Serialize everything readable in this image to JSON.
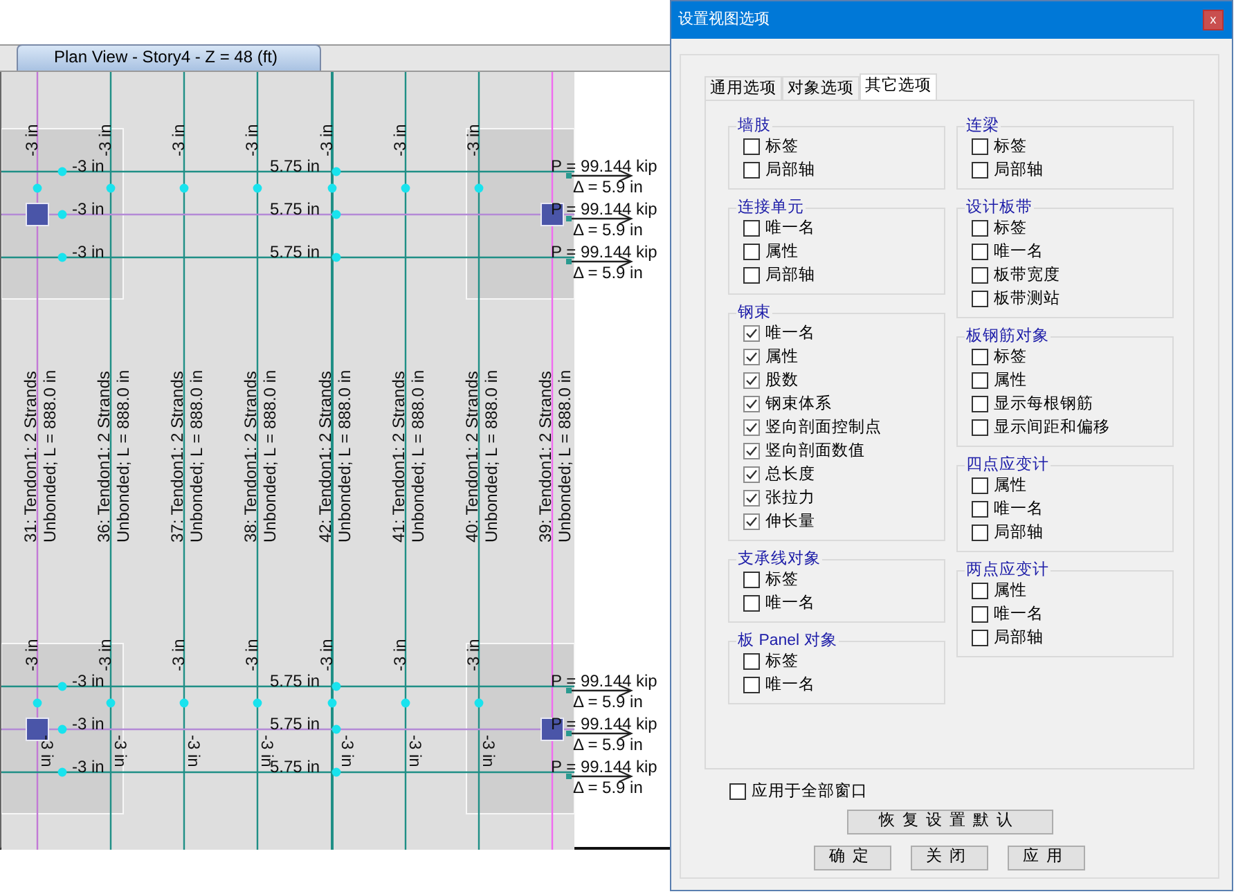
{
  "plan_view": {
    "tab": {
      "label": "Plan View - Story4 - Z = 48 (ft)",
      "selected": true
    },
    "tendons": [
      {
        "name": "31: Tendon1: 2 Strands",
        "detail": "Unbonded; L = 888.0 in"
      },
      {
        "name": "36: Tendon1: 2 Strands",
        "detail": "Unbonded; L = 888.0 in"
      },
      {
        "name": "37: Tendon1: 2 Strands",
        "detail": "Unbonded; L = 888.0 in"
      },
      {
        "name": "38: Tendon1: 2 Strands",
        "detail": "Unbonded; L = 888.0 in"
      },
      {
        "name": "42: Tendon1: 2 Strands",
        "detail": "Unbonded; L = 888.0 in"
      },
      {
        "name": "41: Tendon1: 2 Strands",
        "detail": "Unbonded; L = 888.0 in"
      },
      {
        "name": "40: Tendon1: 2 Strands",
        "detail": "Unbonded; L = 888.0 in"
      },
      {
        "name": "39: Tendon1: 2 Strands",
        "detail": "Unbonded; L = 888.0 in"
      }
    ],
    "top_strip": {
      "offset_labels": [
        "-3 in",
        "-3 in",
        "-3 in",
        "-3 in",
        "-3 in",
        "-3 in",
        "-3 in"
      ],
      "rows": [
        {
          "left": "-3 in",
          "mid": "5.75 in",
          "force": "P = 99.144 kip",
          "displacement": "Δ = 5.9 in"
        },
        {
          "left": "-3 in",
          "mid": "5.75 in",
          "force": "P = 99.144 kip",
          "displacement": "Δ = 5.9 in"
        },
        {
          "left": "-3 in",
          "mid": "5.75 in",
          "force": "P = 99.144 kip",
          "displacement": "Δ = 5.9 in"
        }
      ]
    },
    "bottom_strip": {
      "offset_labels": [
        "-3 in",
        "-3 in",
        "-3 in",
        "-3 in",
        "-3 in",
        "-3 in",
        "-3 in"
      ],
      "row_offset_labels": [
        "-3 in",
        "-3 in",
        "-3 in",
        "-3 in",
        "-3 in",
        "-3 in",
        "-3 in"
      ],
      "rows": [
        {
          "left": "-3 in",
          "mid": "5.75 in",
          "force": "P = 99.144 kip",
          "displacement": "Δ = 5.9 in"
        },
        {
          "left": "-3 in",
          "mid": "5.75 in",
          "force": "P = 99.144 kip",
          "displacement": "Δ = 5.9 in"
        },
        {
          "left": "-3 in",
          "mid": "5.75 in",
          "force": "P = 99.144 kip",
          "displacement": "Δ = 5.9 in"
        }
      ]
    }
  },
  "dialog": {
    "title": "设置视图选项",
    "close": "x",
    "tabs": [
      {
        "label": "通用选项",
        "selected": false
      },
      {
        "label": "对象选项",
        "selected": false
      },
      {
        "label": "其它选项",
        "selected": true
      }
    ],
    "groups_left": [
      {
        "title": "墙肢",
        "options": [
          {
            "label": "标签",
            "checked": false
          },
          {
            "label": "局部轴",
            "checked": false
          }
        ]
      },
      {
        "title": "连接单元",
        "options": [
          {
            "label": "唯一名",
            "checked": false
          },
          {
            "label": "属性",
            "checked": false
          },
          {
            "label": "局部轴",
            "checked": false
          }
        ]
      },
      {
        "title": "钢束",
        "options": [
          {
            "label": "唯一名",
            "checked": true
          },
          {
            "label": "属性",
            "checked": true
          },
          {
            "label": "股数",
            "checked": true
          },
          {
            "label": "钢束体系",
            "checked": true
          },
          {
            "label": "竖向剖面控制点",
            "checked": true
          },
          {
            "label": "竖向剖面数值",
            "checked": true
          },
          {
            "label": "总长度",
            "checked": true
          },
          {
            "label": "张拉力",
            "checked": true
          },
          {
            "label": "伸长量",
            "checked": true
          }
        ]
      },
      {
        "title": "支承线对象",
        "options": [
          {
            "label": "标签",
            "checked": false
          },
          {
            "label": "唯一名",
            "checked": false
          }
        ]
      },
      {
        "title": "板 Panel 对象",
        "options": [
          {
            "label": "标签",
            "checked": false
          },
          {
            "label": "唯一名",
            "checked": false
          }
        ]
      }
    ],
    "groups_right": [
      {
        "title": "连梁",
        "options": [
          {
            "label": "标签",
            "checked": false
          },
          {
            "label": "局部轴",
            "checked": false
          }
        ]
      },
      {
        "title": "设计板带",
        "options": [
          {
            "label": "标签",
            "checked": false
          },
          {
            "label": "唯一名",
            "checked": false
          },
          {
            "label": "板带宽度",
            "checked": false
          },
          {
            "label": "板带测站",
            "checked": false
          }
        ]
      },
      {
        "title": "板钢筋对象",
        "options": [
          {
            "label": "标签",
            "checked": false
          },
          {
            "label": "属性",
            "checked": false
          },
          {
            "label": "显示每根钢筋",
            "checked": false
          },
          {
            "label": "显示间距和偏移",
            "checked": false
          }
        ]
      },
      {
        "title": "四点应变计",
        "options": [
          {
            "label": "属性",
            "checked": false
          },
          {
            "label": "唯一名",
            "checked": false
          },
          {
            "label": "局部轴",
            "checked": false
          }
        ]
      },
      {
        "title": "两点应变计",
        "options": [
          {
            "label": "属性",
            "checked": false
          },
          {
            "label": "唯一名",
            "checked": false
          },
          {
            "label": "局部轴",
            "checked": false
          }
        ]
      }
    ],
    "apply_all": {
      "label": "应用于全部窗口",
      "checked": false
    },
    "reset_button": "恢复设置默认",
    "buttons": [
      "确定",
      "关闭",
      "应用"
    ]
  }
}
